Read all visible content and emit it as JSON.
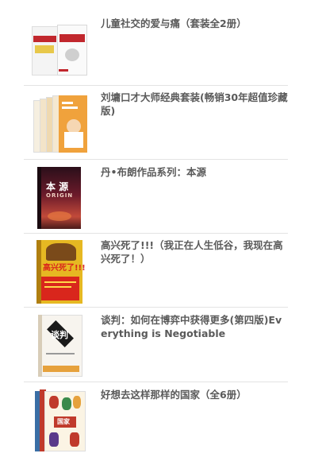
{
  "books": [
    {
      "title": "儿童社交的爱与痛（套装全2册）",
      "cover_icon": "book-cover-children-social",
      "accent": "#c1272d"
    },
    {
      "title": "刘墉口才大师经典套装(畅销30年超值珍藏版)",
      "cover_icon": "book-cover-speech-set",
      "accent": "#f0a23c"
    },
    {
      "title": "丹•布朗作品系列：本源",
      "cover_icon": "book-cover-origin",
      "accent": "#8b1e2b",
      "cover_title": "本 源",
      "cover_subtitle": "ORIGIN"
    },
    {
      "title": "高兴死了!!!（我正在人生低谷，我现在高兴死了！）",
      "cover_icon": "book-cover-happy",
      "accent": "#d9261c",
      "cover_title": "高兴死了!!!"
    },
    {
      "title": "谈判：如何在博弈中获得更多(第四版)Everything is Negotiable",
      "cover_icon": "book-cover-negotiation",
      "accent": "#1a1a1a",
      "cover_title": "谈判"
    },
    {
      "title": "好想去这样那样的国家（全6册）",
      "cover_icon": "book-cover-countries",
      "accent": "#c03a2b",
      "cover_title": "国家"
    }
  ]
}
